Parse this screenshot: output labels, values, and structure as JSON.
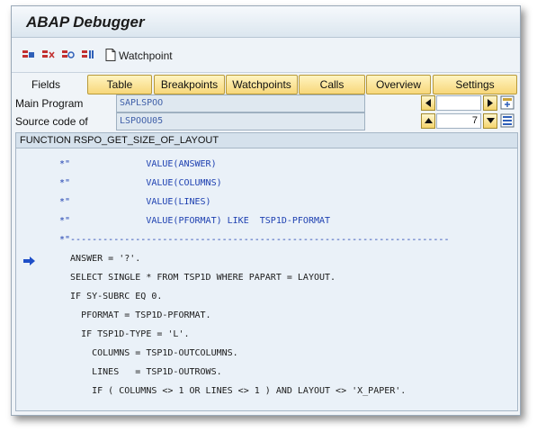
{
  "window": {
    "title": "ABAP Debugger"
  },
  "toolbar": {
    "icons": [
      "breakpoint-set-icon",
      "breakpoint-delete-icon",
      "breakpoint-toggle-icon",
      "breakpoint-list-icon",
      "page-icon"
    ],
    "watchpoint_label": "Watchpoint"
  },
  "tabs": {
    "label": "Fields",
    "items": [
      "Table",
      "Breakpoints",
      "Watchpoints",
      "Calls",
      "Overview",
      "Settings"
    ]
  },
  "fields": {
    "main_program_label": "Main Program",
    "main_program_value": "SAPLSPOO",
    "source_label": "Source code of",
    "source_value": "LSPOOU05",
    "line_number": "7"
  },
  "code": {
    "header": "FUNCTION RSPO_GET_SIZE_OF_LAYOUT",
    "lines": [
      "*\"              VALUE(ANSWER)",
      "*\"              VALUE(COLUMNS)",
      "*\"              VALUE(LINES)",
      "*\"              VALUE(PFORMAT) LIKE  TSP1D-PFORMAT",
      "*\"----------------------------------------------------------------------",
      "  ANSWER = '?'.",
      "  SELECT SINGLE * FROM TSP1D WHERE PAPART = LAYOUT.",
      "  IF SY-SUBRC EQ 0.",
      "    PFORMAT = TSP1D-PFORMAT.",
      "    IF TSP1D-TYPE = 'L'.",
      "      COLUMNS = TSP1D-OUTCOLUMNS.",
      "      LINES   = TSP1D-OUTROWS.",
      "      IF ( COLUMNS <> 1 OR LINES <> 1 ) AND LAYOUT <> 'X_PAPER'."
    ],
    "current_line_index": 5
  },
  "colors": {
    "tab_fill": "#f7d77a",
    "comment_blue": "#1c3fb0",
    "arrow_blue": "#1f4fc8"
  }
}
